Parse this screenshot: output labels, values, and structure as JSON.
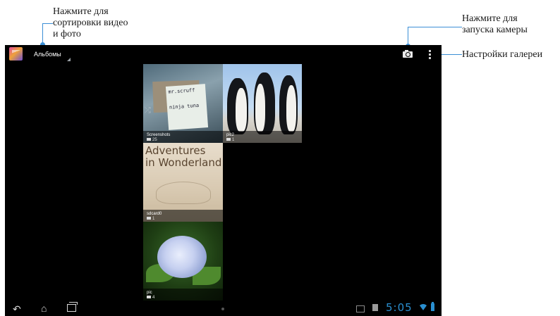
{
  "annotations": {
    "sort": "Нажмите для\nсортировки видео\nи фото",
    "camera": "Нажмите для\nзапуска камеры",
    "settings": "Настройки галереи"
  },
  "actionbar": {
    "app_icon": "gallery-app-icon",
    "title": "Альбомы",
    "camera_icon": "camera-icon",
    "menu_icon": "overflow-menu-icon"
  },
  "albums": [
    {
      "name": "Screenshots",
      "count": "25"
    },
    {
      "name": "pic2",
      "count": "1"
    },
    {
      "name": "sdcard0",
      "count": "1"
    },
    {
      "name": "pic",
      "count": "4"
    }
  ],
  "tile_art": {
    "card_text": [
      "mr.scruff",
      "ninja tuna"
    ],
    "book_title": "Adventures\nin Wonderland"
  },
  "navbar": {
    "back": "back-icon",
    "home": "home-icon",
    "recent": "recent-apps-icon"
  },
  "status": {
    "time": "5:05",
    "accent": "#2a8fd0"
  }
}
